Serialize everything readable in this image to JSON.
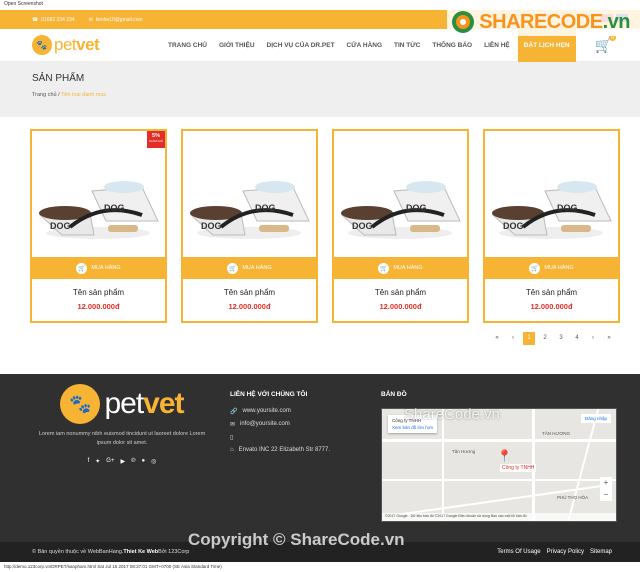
{
  "window_title": "Open Screenshot",
  "topbar": {
    "phone": "01682 234 234",
    "email": "lienhe10@gmail.com"
  },
  "watermark": {
    "brand_a": "SHARECODE",
    "brand_b": ".vn",
    "center": "ShareCode.vn",
    "copyright": "Copyright © ShareCode.vn"
  },
  "logo": {
    "pet": "pet",
    "vet": "vet"
  },
  "nav": {
    "items": [
      "TRANG CHỦ",
      "GIỚI THIỆU",
      "DỊCH VỤ CỦA DR.PET",
      "CỬA HÀNG",
      "TIN TỨC",
      "THÔNG BÁO",
      "LIÊN HỆ"
    ],
    "cta": "ĐẶT LỊCH HẸN",
    "cart_count": "0"
  },
  "banner": {
    "title": "SẢN PHẨM",
    "crumb_home": "Trang chủ",
    "crumb_sep": " / ",
    "crumb_current": "Tên loại danh mục"
  },
  "products": [
    {
      "name": "Tên sản phẩm",
      "price": "12.000.000đ",
      "buy": "MUA HÀNG",
      "sale": "5%",
      "sale_sub": "GIẢM GIÁ"
    },
    {
      "name": "Tên sản phẩm",
      "price": "12.000.000đ",
      "buy": "MUA HÀNG"
    },
    {
      "name": "Tên sản phẩm",
      "price": "12.000.000đ",
      "buy": "MUA HÀNG"
    },
    {
      "name": "Tên sản phẩm",
      "price": "12.000.000đ",
      "buy": "MUA HÀNG"
    }
  ],
  "product_image_label": "DOG",
  "pagination": {
    "first": "«",
    "prev": "‹",
    "pages": [
      "1",
      "2",
      "3",
      "4"
    ],
    "next": "›",
    "last": "»",
    "active": "1"
  },
  "footer": {
    "desc": "Lorem iam nonummy nibh euismod tincidunt ut laoreet dolore Lorem ipsum dolor sit amet.",
    "contact_title": "LIÊN HỆ VỚI CHÚNG TÔI",
    "website": "www.yoursite.com",
    "email": "info@yoursite.com",
    "address": "Envato INC 22 Elizabeth Str 8777.",
    "map_title": "BẢN ĐỒ",
    "map_card": "Công ty TNHH",
    "map_link": "Xem bản đồ lớn hơn",
    "map_signin": "Đăng nhập",
    "map_pin": "Công ty TNHH",
    "map_area1": "TÂN HƯƠNG",
    "map_area2": "PHÚ THỌ HÒA",
    "map_area3": "Tân Hương",
    "map_attr": "©2017 Google · Dữ liệu bản đồ ©2017 Google   Điều khoản sử dụng   Báo cáo một lỗi bản đồ",
    "map_zoom_in": "+",
    "map_zoom_out": "−",
    "copyright_prefix": "© Bản quyền thuộc về WebBanHang. ",
    "copyright_bold": "Thiet Ke Web",
    "copyright_suffix": " Bởi 123Corp",
    "links": [
      "Terms Of Usage",
      "Privacy Policy",
      "Sitemap"
    ]
  },
  "status": "http://demo.123corp.vn/DRPET/sanpham.html Sat Jul 15 2017 08:37:01 GMT+0700 (SE Asia Standard Time)"
}
